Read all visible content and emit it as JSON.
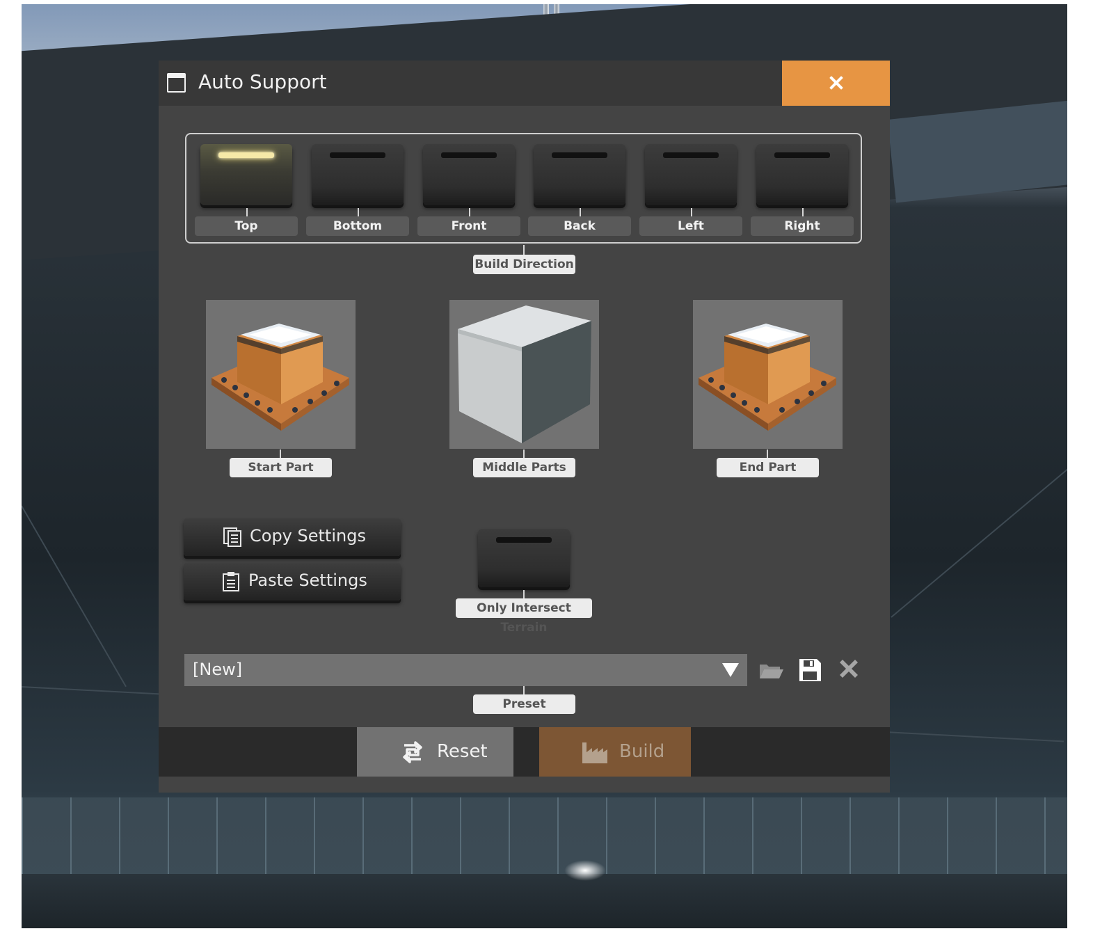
{
  "window": {
    "title": "Auto Support",
    "close_icon": "close-icon",
    "accent_color": "#e79543"
  },
  "build_direction": {
    "label": "Build Direction",
    "options": [
      {
        "label": "Top",
        "active": true
      },
      {
        "label": "Bottom",
        "active": false
      },
      {
        "label": "Front",
        "active": false
      },
      {
        "label": "Back",
        "active": false
      },
      {
        "label": "Left",
        "active": false
      },
      {
        "label": "Right",
        "active": false
      }
    ]
  },
  "parts": {
    "start": {
      "label": "Start Part",
      "icon": "support-base-icon"
    },
    "middle": {
      "label": "Middle Parts",
      "icon": "concrete-block-icon"
    },
    "end": {
      "label": "End Part",
      "icon": "support-base-icon"
    }
  },
  "actions": {
    "copy_label": "Copy Settings",
    "paste_label": "Paste Settings"
  },
  "terrain_toggle": {
    "label": "Only Intersect Terrain",
    "active": false
  },
  "preset": {
    "label": "Preset",
    "selected": "[New]",
    "icons": [
      "folder-open-icon",
      "save-icon",
      "delete-icon"
    ]
  },
  "footer": {
    "reset_label": "Reset",
    "build_label": "Build",
    "build_color": "#7d5634"
  }
}
